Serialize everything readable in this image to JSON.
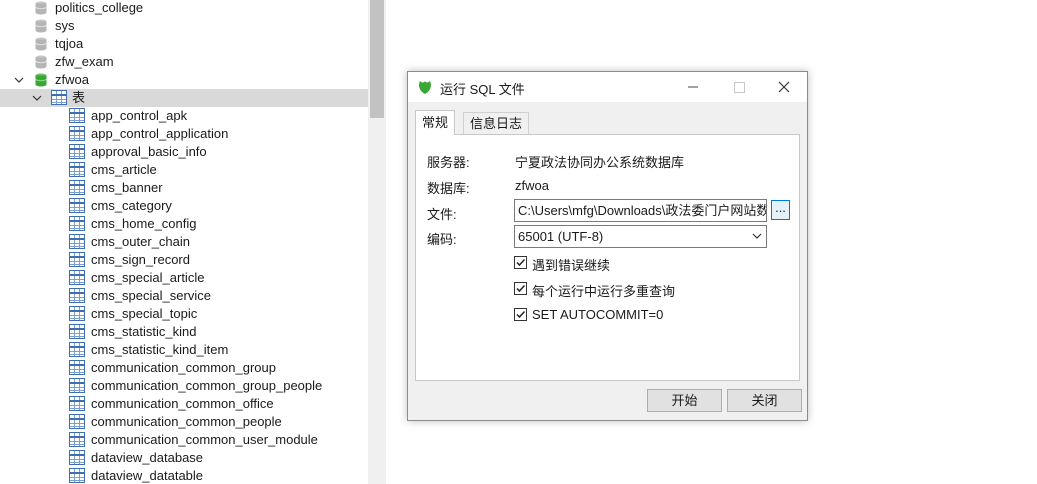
{
  "tree": {
    "databases_above": [
      "politics_college",
      "sys",
      "tqjoa",
      "zfw_exam"
    ],
    "open_database": "zfwoa",
    "tables_node": "表",
    "tables": [
      "app_control_apk",
      "app_control_application",
      "approval_basic_info",
      "cms_article",
      "cms_banner",
      "cms_category",
      "cms_home_config",
      "cms_outer_chain",
      "cms_sign_record",
      "cms_special_article",
      "cms_special_service",
      "cms_special_topic",
      "cms_statistic_kind",
      "cms_statistic_kind_item",
      "communication_common_group",
      "communication_common_group_people",
      "communication_common_office",
      "communication_common_people",
      "communication_common_user_module",
      "dataview_database",
      "dataview_datatable"
    ]
  },
  "dialog": {
    "title": "运行 SQL 文件",
    "tabs": [
      "常规",
      "信息日志"
    ],
    "server_label": "服务器:",
    "server_value": "宁夏政法协同办公系统数据库",
    "database_label": "数据库:",
    "database_value": "zfwoa",
    "file_label": "文件:",
    "file_value": "C:\\Users\\mfg\\Downloads\\政法委门户网站数",
    "browse_label": "...",
    "encoding_label": "编码:",
    "encoding_value": "65001 (UTF-8)",
    "options": [
      {
        "label": "遇到错误继续",
        "checked": true
      },
      {
        "label": "每个运行中运行多重查询",
        "checked": true
      },
      {
        "label": "SET AUTOCOMMIT=0",
        "checked": true
      }
    ],
    "start_button": "开始",
    "close_button": "关闭"
  },
  "colors": {
    "selection": "#d9d9d9",
    "db_icon_gray": "#b5b5b5",
    "db_icon_green": "#3aa635",
    "table_icon_blue": "#3f6fb0",
    "focus_blue": "#0078d7"
  },
  "icons": {
    "database": "database-cylinder-icon",
    "table": "table-grid-icon",
    "dialog": "navicat-leaf-icon"
  }
}
